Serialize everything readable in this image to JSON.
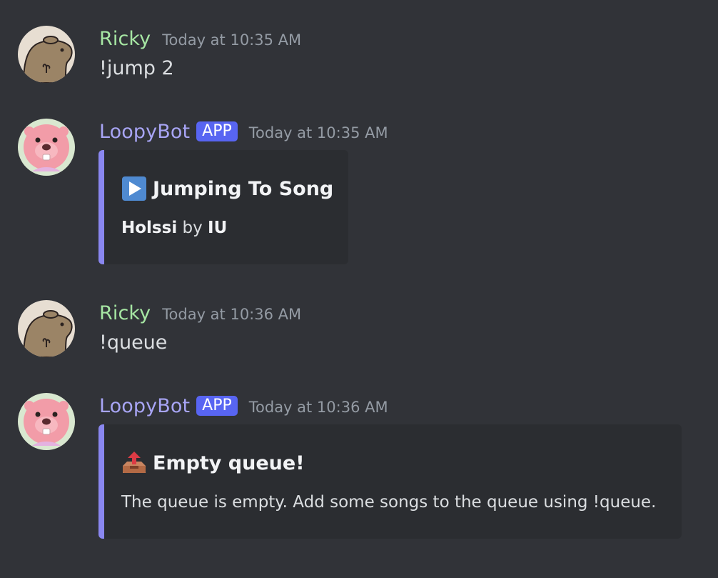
{
  "messages": [
    {
      "author": "Ricky",
      "timestamp": "Today at 10:35 AM",
      "text": "!jump 2"
    },
    {
      "author": "LoopyBot",
      "badge": "APP",
      "timestamp": "Today at 10:35 AM",
      "embed": {
        "icon": "play-button-icon",
        "title": "Jumping To Song",
        "song": "Holssi",
        "by": "by",
        "artist": "IU"
      }
    },
    {
      "author": "Ricky",
      "timestamp": "Today at 10:36 AM",
      "text": "!queue"
    },
    {
      "author": "LoopyBot",
      "badge": "APP",
      "timestamp": "Today at 10:36 AM",
      "embed": {
        "icon": "outbox-tray-icon",
        "title": "Empty queue!",
        "description": "The queue is empty. Add some songs to the queue using !queue."
      }
    }
  ],
  "colors": {
    "background": "#313338",
    "embed_background": "#2b2d31",
    "embed_accent": "#8a87f0",
    "ricky_name": "#a6e6a3",
    "bot_name": "#a8a5f5",
    "app_badge": "#5865f2",
    "timestamp": "#949ba4"
  }
}
